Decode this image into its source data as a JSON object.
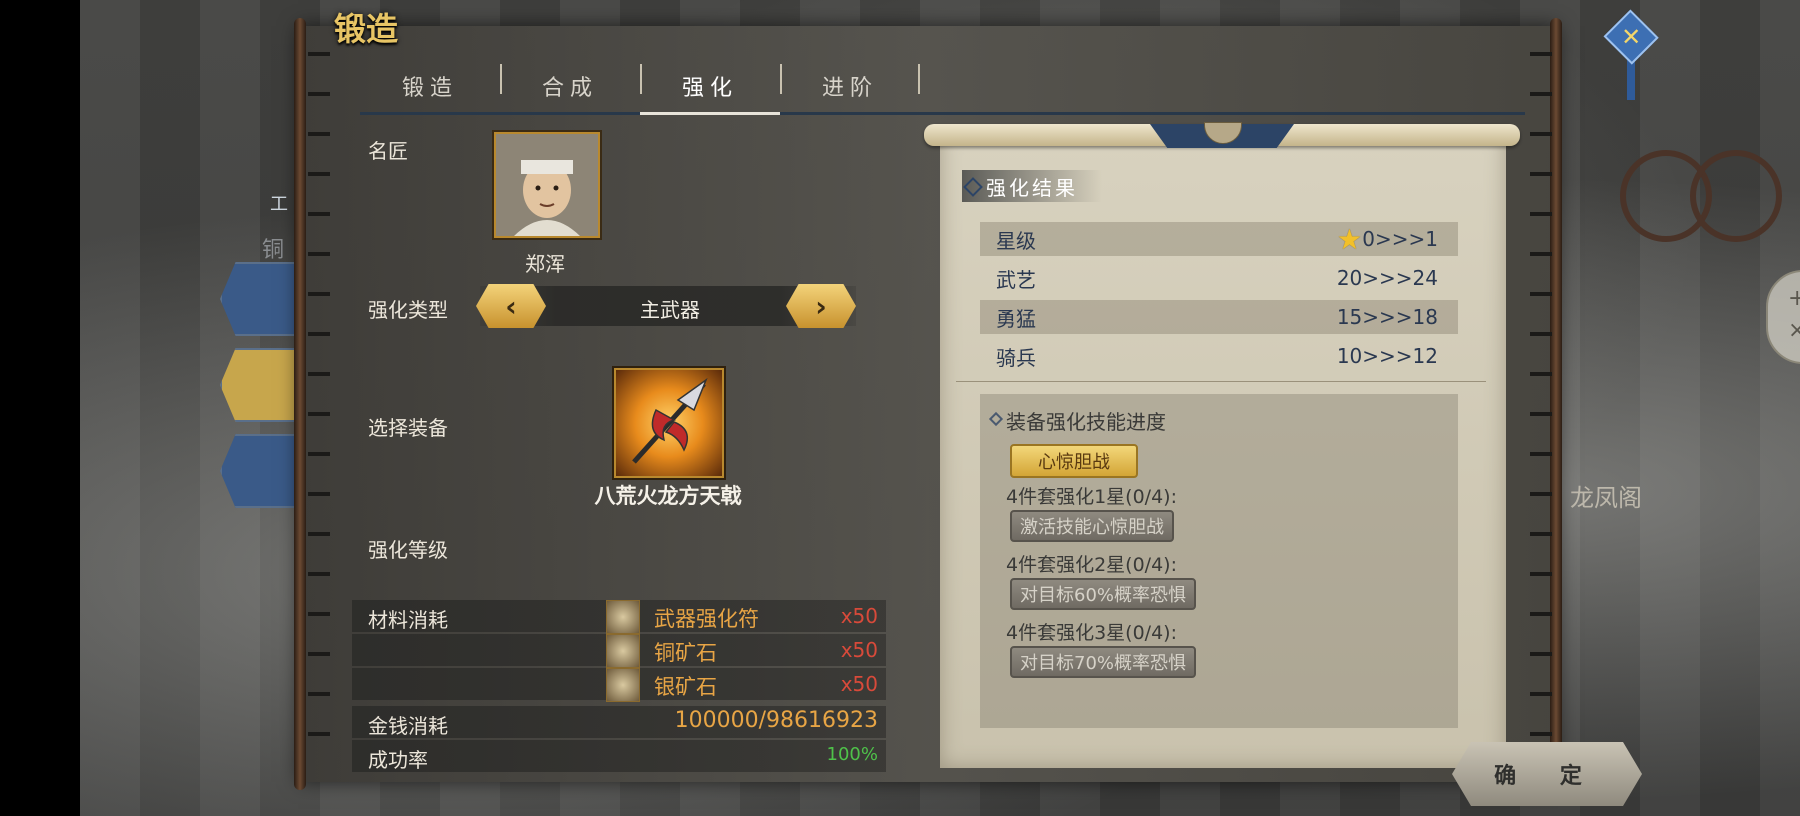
{
  "window": {
    "title": "锻造",
    "close_icon": "close-x"
  },
  "tabs": [
    {
      "label": "锻造",
      "active": false
    },
    {
      "label": "合成",
      "active": false
    },
    {
      "label": "强化",
      "active": true
    },
    {
      "label": "进阶",
      "active": false
    }
  ],
  "background": {
    "building_label": "龙凤阁"
  },
  "side_nav": {
    "partial_label": "工",
    "partial_label2": "铜"
  },
  "form": {
    "craftsman_label": "名匠",
    "craftsman_name": "郑浑",
    "enhance_type_label": "强化类型",
    "enhance_type_value": "主武器",
    "select_equip_label": "选择装备",
    "equip_name": "八荒火龙方天戟",
    "enhance_level_label": "强化等级",
    "materials_label": "材料消耗",
    "materials": [
      {
        "name": "武器强化符",
        "qty": "x50",
        "icon": "talisman-icon"
      },
      {
        "name": "铜矿石",
        "qty": "x50",
        "icon": "copper-ore-icon"
      },
      {
        "name": "银矿石",
        "qty": "x50",
        "icon": "silver-ore-icon"
      }
    ],
    "gold_label": "金钱消耗",
    "gold_value": "100000/98616923",
    "success_label": "成功率",
    "success_value": "100%"
  },
  "result": {
    "header": "强化结果",
    "stats": [
      {
        "name": "星级",
        "value": "0>>>1",
        "star": true
      },
      {
        "name": "武艺",
        "value": "20>>>24"
      },
      {
        "name": "勇猛",
        "value": "15>>>18"
      },
      {
        "name": "骑兵",
        "value": "10>>>12"
      }
    ],
    "skill_title": "装备强化技能进度",
    "skill_active": "心惊胆战",
    "skill_levels": [
      {
        "req": "4件套强化1星(0/4):",
        "effect": "激活技能心惊胆战"
      },
      {
        "req": "4件套强化2星(0/4):",
        "effect": "对目标60%概率恐惧"
      },
      {
        "req": "4件套强化3星(0/4):",
        "effect": "对目标70%概率恐惧"
      }
    ]
  },
  "confirm_label": "确 定",
  "colors": {
    "title_gold": "#e8c565",
    "material_orange": "#e8a545",
    "qty_red": "#d84a3a",
    "success_green": "#4fc24a",
    "stat_navy": "#2a3850"
  }
}
